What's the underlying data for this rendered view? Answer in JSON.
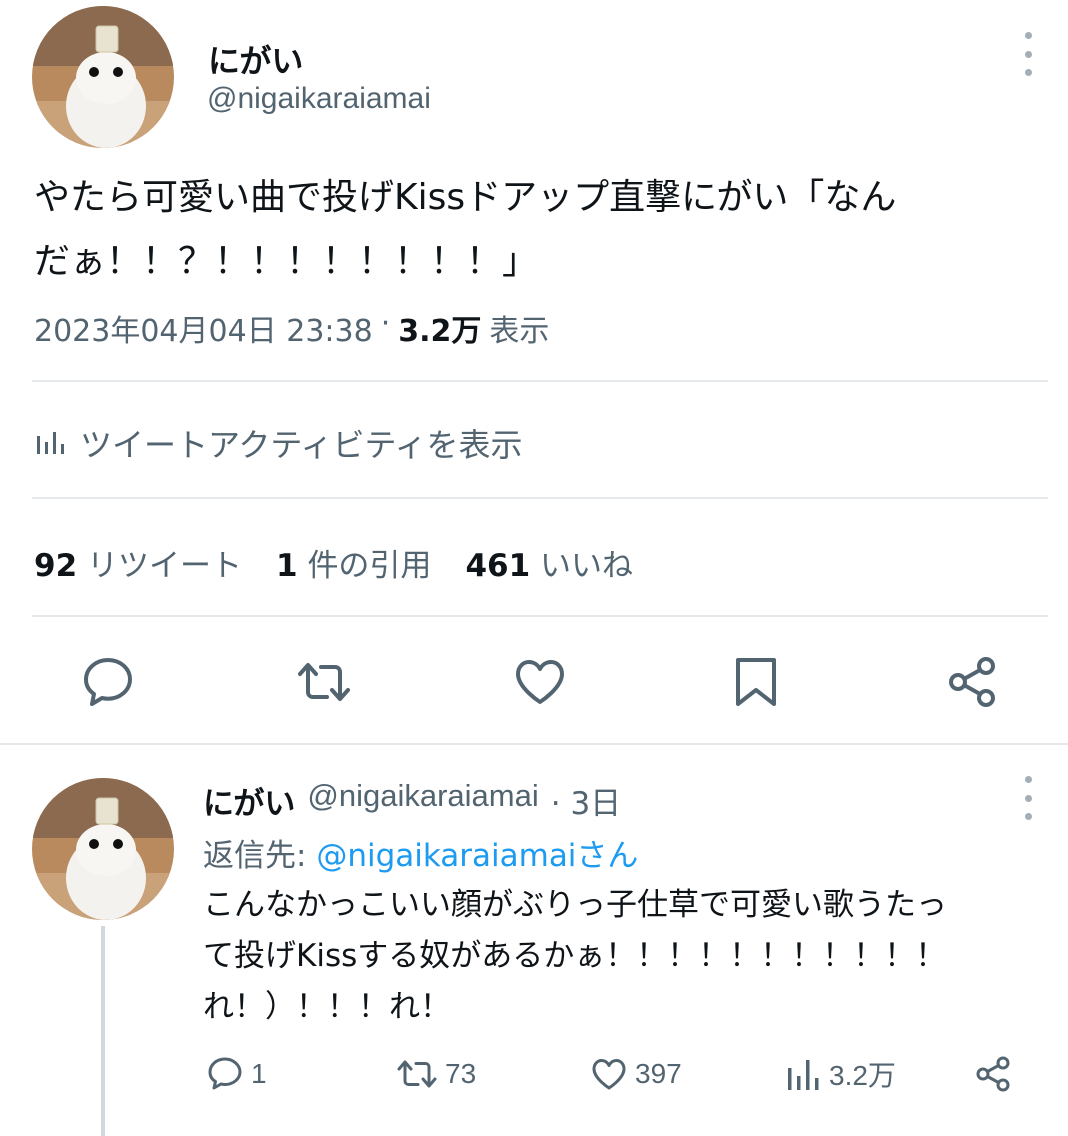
{
  "main_tweet": {
    "display_name": "にがい",
    "handle": "@nigaikaraiamai",
    "text_line1": "やたら可愛い曲で投げKissドアップ直撃にがい「なん",
    "text_line2": "だぁ！！？！！！！！！！！」",
    "timestamp": "2023年04月04日 23:38",
    "separator": "·",
    "views_count": "3.2万",
    "views_label": "表示",
    "activity_label": "ツイートアクティビティを表示",
    "stats": {
      "retweets_count": "92",
      "retweets_label": "リツイート",
      "quotes_count": "1",
      "quotes_label": "件の引用",
      "likes_count": "461",
      "likes_label": "いいね"
    }
  },
  "reply_tweet": {
    "display_name": "にがい",
    "handle": "@nigaikaraiamai",
    "time_ago": "· 3日",
    "reply_to_label": "返信先: ",
    "reply_to_handle": "@nigaikaraiamai",
    "reply_to_suffix": "さん",
    "text_line1": "こんなかっこいい顔がぶりっ子仕草で可愛い歌うたっ",
    "text_line2": "て投げKissする奴があるかぁ！！！！！！！！！！！",
    "text_line3": "れ！）！！！れ！",
    "replies": "1",
    "retweets": "73",
    "likes": "397",
    "views": "3.2万"
  },
  "icons": [
    "kebab-icon",
    "reply-icon",
    "retweet-icon",
    "like-icon",
    "bookmark-icon",
    "share-icon",
    "analytics-icon"
  ],
  "colors": {
    "text": "#0f1419",
    "secondary": "#536471",
    "link": "#1d9bf0",
    "divider": "#e6e9eb"
  }
}
